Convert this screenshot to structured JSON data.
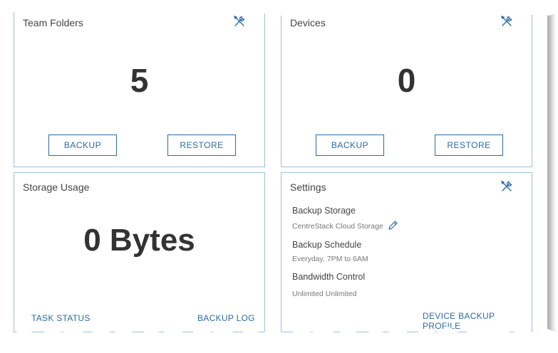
{
  "panels": {
    "team_folders": {
      "title": "Team Folders",
      "count": "5",
      "backup_label": "BACKUP",
      "restore_label": "RESTORE",
      "icon": "tools-icon"
    },
    "devices": {
      "title": "Devices",
      "count": "0",
      "backup_label": "BACKUP",
      "restore_label": "RESTORE",
      "icon": "tools-icon"
    },
    "storage_usage": {
      "title": "Storage Usage",
      "value": "0 Bytes",
      "task_status_label": "TASK STATUS",
      "backup_log_label": "BACKUP LOG"
    },
    "settings": {
      "title": "Settings",
      "icon": "tools-icon",
      "backup_storage_label": "Backup Storage",
      "backup_storage_value": "CentreStack Cloud Storage",
      "edit_icon": "pencil-icon",
      "backup_schedule_label": "Backup Schedule",
      "backup_schedule_value": "Everyday, 7PM to 6AM",
      "bandwidth_label": "Bandwidth Control",
      "bandwidth_value": "Unlimited Unlimited",
      "device_backup_profile_label": "DEVICE BACKUP PROFILE"
    }
  },
  "colors": {
    "accent": "#2b6aa8",
    "panel_border": "#9fc0d8",
    "text": "#333333"
  }
}
